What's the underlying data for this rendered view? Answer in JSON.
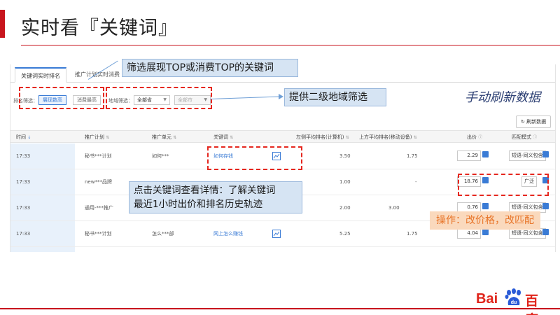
{
  "slide": {
    "title": "实时看『关键词』"
  },
  "tabs": [
    {
      "label": "关键词实时排名"
    },
    {
      "label": "推广计划实时消费"
    }
  ],
  "filters": {
    "type_label": "排名筛选：",
    "type_options": [
      "展现数高",
      "消费最高"
    ],
    "region_label": "地域筛选：",
    "province_value": "全部省",
    "city_value": "全部市"
  },
  "refresh_button": "刷新数据",
  "manual_refresh_text": "手动刷新数据",
  "table": {
    "headers": [
      "时间",
      "推广计划",
      "推广单元",
      "关键词",
      "左侧平均排名(计算机)",
      "上方平均排名(移动设备)",
      "出价",
      "匹配模式"
    ],
    "rows": [
      {
        "time": "17:33",
        "plan": "秘书***计划",
        "unit": "如何***",
        "keyword": "如何存钱",
        "left_rank": "3.50",
        "top_rank": "1.75",
        "bid": "2.29",
        "match": "短语-同义包含"
      },
      {
        "time": "17:33",
        "plan": "new***品牌",
        "unit": "",
        "keyword": "",
        "left_rank": "1.00",
        "top_rank": "-",
        "bid": "18.76",
        "match": "广泛"
      },
      {
        "time": "17:33",
        "plan": "通用-***推广",
        "unit": "",
        "keyword": "",
        "left_rank": "2.00",
        "top_rank": "3.00",
        "bid": "0.76",
        "match": "短语-同义包含"
      },
      {
        "time": "17:33",
        "plan": "秘书***计划",
        "unit": "怎么***部",
        "keyword": "网上怎么赚钱",
        "left_rank": "5.25",
        "top_rank": "1.75",
        "bid": "4.04",
        "match": "短语-同义包含"
      }
    ]
  },
  "callouts": {
    "filter_top": "筛选展现TOP或消费TOP的关键词",
    "region": "提供二级地域筛选",
    "keyword_detail_line1": "点击关键词查看详情：了解关键词",
    "keyword_detail_line2": "最近1小时出价和排名历史轨迹",
    "action": "操作：改价格，改匹配"
  },
  "logo": {
    "latin": "Bai",
    "badge": "du",
    "chinese": "百度"
  },
  "colors": {
    "brand_red": "#c8151d",
    "link_blue": "#3a7bd5",
    "callout_bg": "#d6e4f3",
    "action_orange": "#e87529"
  }
}
